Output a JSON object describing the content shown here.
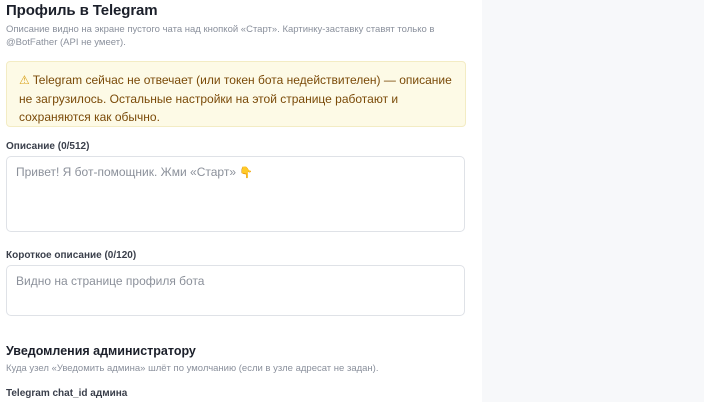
{
  "profile": {
    "title": "Профиль в Telegram",
    "description_line1": "Описание видно на экране пустого чата над кнопкой «Старт». Картинку-заставку ставят только в",
    "description_line2": "@BotFather (API не умеет)."
  },
  "warning": {
    "icon": "warning-icon",
    "text": "Telegram сейчас не отвечает (или токен бота недействителен) — описание не загрузилось. Остальные настройки на этой странице работают и сохраняются как обычно."
  },
  "description_field": {
    "label": "Описание (0/512)",
    "placeholder": "Привет! Я бот-помощник. Жми «Старт»",
    "placeholder_emoji": "👇"
  },
  "short_description_field": {
    "label": "Короткое описание (0/120)",
    "placeholder": "Видно на странице профиля бота"
  },
  "admin_notifications": {
    "title": "Уведомления администратору",
    "subtitle": "Куда узел «Уведомить админа» шлёт по умолчанию (если в узле адресат не задан).",
    "chat_id_label": "Telegram chat_id админа"
  }
}
